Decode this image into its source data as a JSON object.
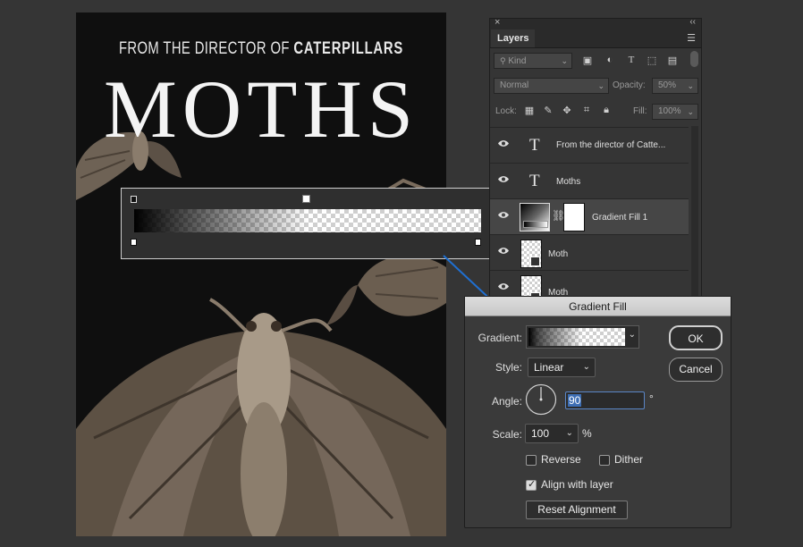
{
  "poster": {
    "tagline_prefix": "FROM THE DIRECTOR OF",
    "tagline_bold": "CATERPILLARS",
    "title": "MOTHS"
  },
  "layers_panel": {
    "tab_label": "Layers",
    "filter_kind": "Kind",
    "blend_mode": "Normal",
    "opacity_label": "Opacity:",
    "opacity_value": "50%",
    "lock_label": "Lock:",
    "fill_label": "Fill:",
    "fill_value": "100%",
    "layers": [
      {
        "name": "From the director of Catte...",
        "kind": "text"
      },
      {
        "name": "Moths",
        "kind": "text"
      },
      {
        "name": "Gradient Fill 1",
        "kind": "gradient-fill",
        "selected": true
      },
      {
        "name": "Moth",
        "kind": "smart-object"
      },
      {
        "name": "Moth",
        "kind": "smart-object"
      }
    ]
  },
  "gradient_fill_dialog": {
    "title": "Gradient Fill",
    "gradient_label": "Gradient:",
    "style_label": "Style:",
    "style_value": "Linear",
    "angle_label": "Angle:",
    "angle_value": "90",
    "angle_unit": "°",
    "scale_label": "Scale:",
    "scale_value": "100",
    "scale_unit": "%",
    "reverse_label": "Reverse",
    "reverse_checked": false,
    "dither_label": "Dither",
    "dither_checked": false,
    "align_label": "Align with layer",
    "align_checked": true,
    "reset_label": "Reset Alignment",
    "ok_label": "OK",
    "cancel_label": "Cancel"
  },
  "colors": {
    "accent_blue": "#1f6fd1",
    "selection_highlight": "#3d6eb4"
  }
}
